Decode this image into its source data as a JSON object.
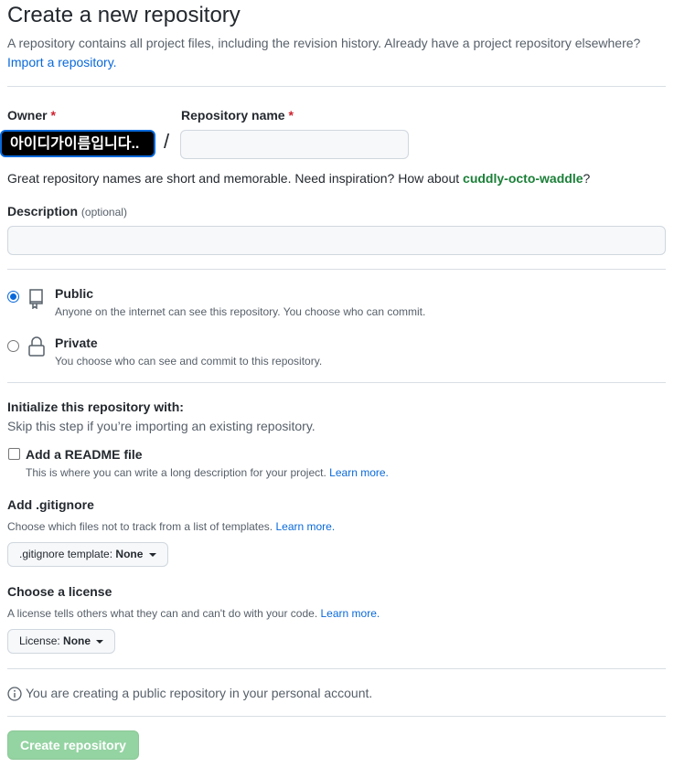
{
  "header": {
    "title": "Create a new repository",
    "subtitle": "A repository contains all project files, including the revision history. Already have a project repository elsewhere?",
    "import_link": "Import a repository."
  },
  "owner": {
    "label": "Owner",
    "required_mark": "*",
    "value": "아이디가이름입니다.."
  },
  "separator": "/",
  "repo_name": {
    "label": "Repository name",
    "required_mark": "*",
    "value": "",
    "placeholder": ""
  },
  "name_hint": {
    "text": "Great repository names are short and memorable. Need inspiration? How about",
    "suggestion": "cuddly-octo-waddle",
    "suffix": "?"
  },
  "description": {
    "label": "Description",
    "optional": "(optional)",
    "value": "",
    "placeholder": ""
  },
  "visibility": {
    "public": {
      "label": "Public",
      "desc": "Anyone on the internet can see this repository. You choose who can commit.",
      "selected": true
    },
    "private": {
      "label": "Private",
      "desc": "You choose who can see and commit to this repository.",
      "selected": false
    }
  },
  "init": {
    "heading": "Initialize this repository with:",
    "sub": "Skip this step if you’re importing an existing repository.",
    "readme": {
      "label": "Add a README file",
      "desc": "This is where you can write a long description for your project.",
      "link": "Learn more.",
      "checked": false
    }
  },
  "gitignore": {
    "heading": "Add .gitignore",
    "desc": "Choose which files not to track from a list of templates.",
    "link": "Learn more.",
    "button_prefix": ".gitignore template:",
    "button_value": "None"
  },
  "license": {
    "heading": "Choose a license",
    "desc": "A license tells others what they can and can't do with your code.",
    "link": "Learn more.",
    "button_prefix": "License:",
    "button_value": "None"
  },
  "notice": "You are creating a public repository in your personal account.",
  "submit": {
    "label": "Create repository"
  },
  "colors": {
    "accent": "#0969da",
    "suggestion": "#1a7f37",
    "required": "#cf222e",
    "submit_disabled": "#94d3a2"
  },
  "icons": [
    "repo-icon",
    "lock-icon",
    "info-icon",
    "caret-down-icon"
  ]
}
